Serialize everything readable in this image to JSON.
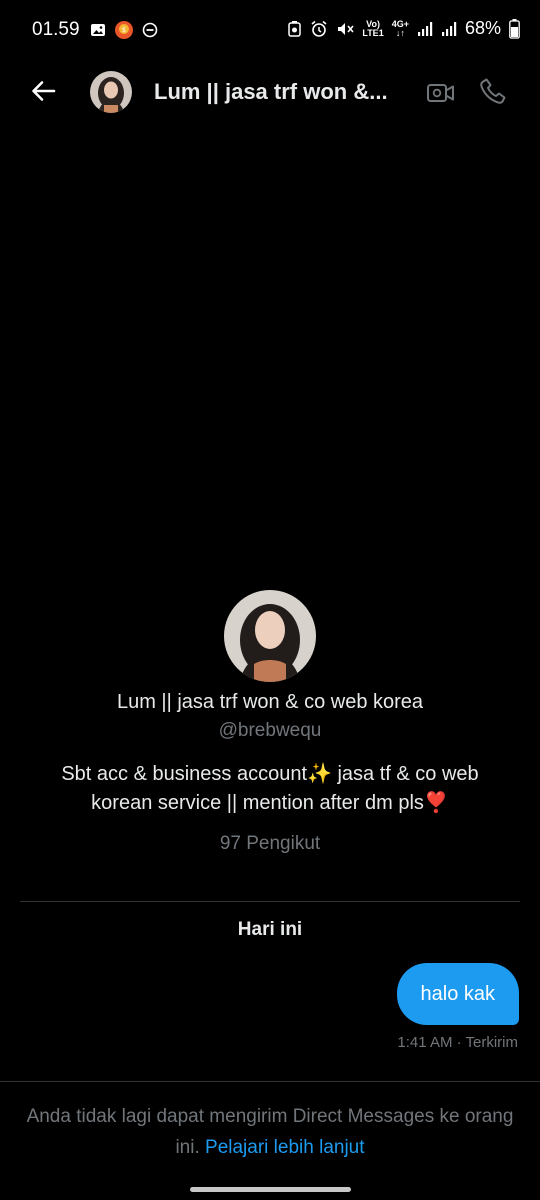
{
  "status_bar": {
    "time": "01.59",
    "network_top": "Vo)",
    "network_bottom": "LTE1",
    "network_type": "4G+",
    "battery": "68%"
  },
  "header": {
    "title": "Lum || jasa trf won &..."
  },
  "profile": {
    "name": "Lum || jasa trf won & co web korea",
    "handle": "@brebwequ",
    "bio": "Sbt acc & business account✨ jasa tf & co web korean service || mention after dm pls❣️",
    "followers": "97 Pengikut"
  },
  "conversation": {
    "date_label": "Hari ini",
    "messages": [
      {
        "text": "halo kak",
        "meta": "1:41 AM · Terkirim",
        "direction": "outgoing"
      }
    ]
  },
  "footer": {
    "notice": "Anda tidak lagi dapat mengirim Direct Messages ke orang ini.",
    "link": "Pelajari lebih lanjut"
  },
  "colors": {
    "background": "#000000",
    "accent": "#1d9bf0",
    "secondary_text": "#71767b",
    "divider": "#2f3336"
  }
}
